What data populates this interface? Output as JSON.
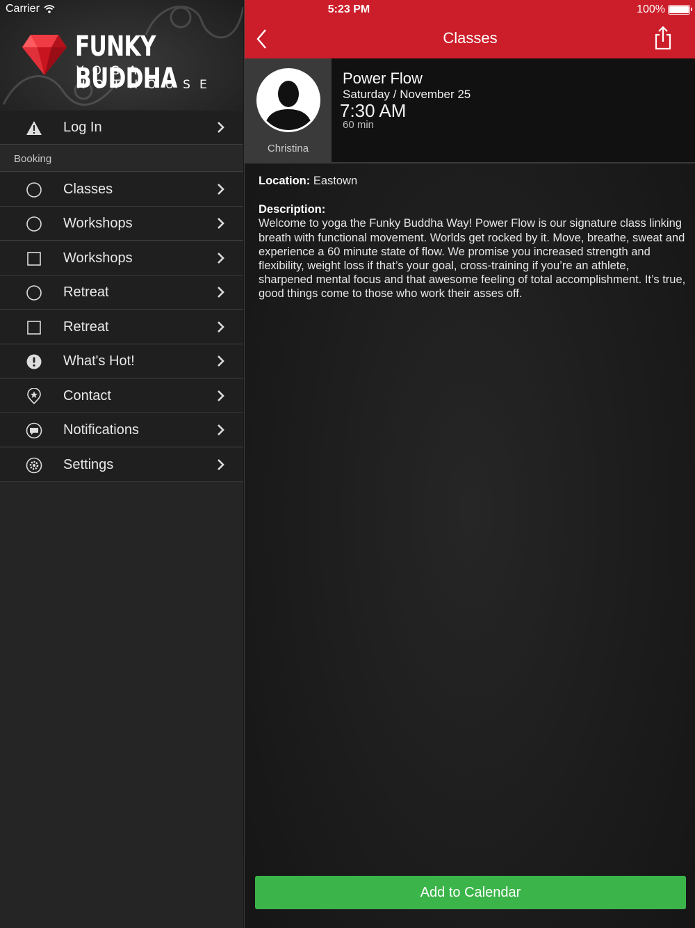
{
  "status_bar": {
    "carrier": "Carrier",
    "time": "5:23 PM",
    "battery": "100%"
  },
  "logo": {
    "title": "FUNKY BUDDHA",
    "subtitle": "YOGA HOTHOUSE"
  },
  "sidebar": {
    "login": {
      "label": "Log In",
      "icon": "warning-icon"
    },
    "section_label": "Booking",
    "items": [
      {
        "label": "Classes",
        "icon": "circle-icon"
      },
      {
        "label": "Workshops",
        "icon": "circle-icon"
      },
      {
        "label": "Workshops",
        "icon": "square-icon"
      },
      {
        "label": "Retreat",
        "icon": "circle-icon"
      },
      {
        "label": "Retreat",
        "icon": "square-icon"
      },
      {
        "label": "What's Hot!",
        "icon": "exclamation-icon"
      },
      {
        "label": "Contact",
        "icon": "location-pin-icon"
      },
      {
        "label": "Notifications",
        "icon": "chat-bubble-icon"
      },
      {
        "label": "Settings",
        "icon": "gear-icon"
      }
    ]
  },
  "navbar": {
    "title": "Classes",
    "accent": "#cc1e2a"
  },
  "class": {
    "name": "Power Flow",
    "date": "Saturday / November 25",
    "time": "7:30 AM",
    "duration": "60 min",
    "instructor": "Christina",
    "location_label": "Location:",
    "location": "Eastown",
    "description_label": "Description:",
    "description": "Welcome to yoga the Funky Buddha Way! Power Flow is our signature class linking breath with functional movement. Worlds get rocked by it. Move, breathe, sweat and experience a 60 minute state of flow. We promise you increased strength and flexibility, weight loss if that’s your goal, cross-training if you’re an athlete, sharpened mental focus and that awesome feeling of total accomplishment. It’s true, good things come to those who work their asses off."
  },
  "actions": {
    "add_to_calendar": "Add to Calendar",
    "button_color": "#3bb54a"
  }
}
